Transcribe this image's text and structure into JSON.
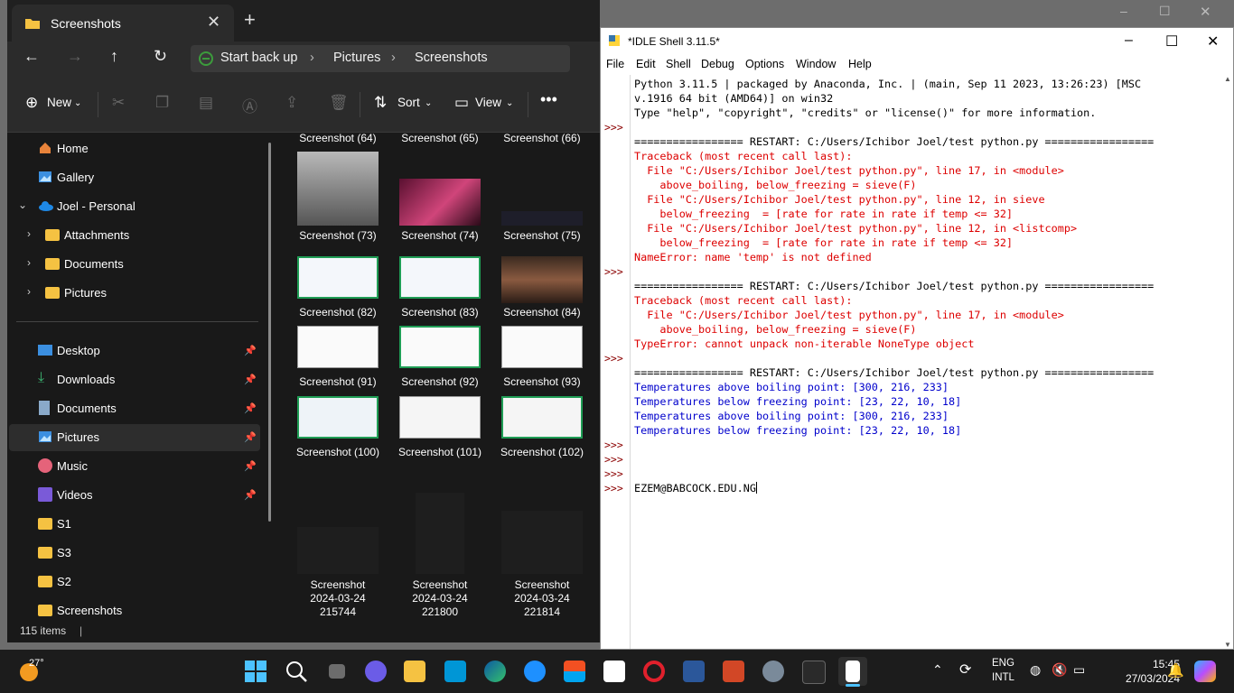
{
  "explorer": {
    "tab_title": "Screenshots",
    "breadcrumb": [
      "Start back up",
      "Pictures",
      "Screenshots"
    ],
    "toolbar": {
      "new_label": "New",
      "sort_label": "Sort",
      "view_label": "View"
    },
    "sidebar": {
      "top": [
        "Home",
        "Gallery",
        "Joel - Personal",
        "Attachments",
        "Documents",
        "Pictures"
      ],
      "quick": [
        "Desktop",
        "Downloads",
        "Documents",
        "Pictures",
        "Music",
        "Videos",
        "S1",
        "S3",
        "S2",
        "Screenshots"
      ]
    },
    "files": [
      "Screenshot (64)",
      "Screenshot (65)",
      "Screenshot (66)",
      "Screenshot (73)",
      "Screenshot (74)",
      "Screenshot (75)",
      "Screenshot (82)",
      "Screenshot (83)",
      "Screenshot (84)",
      "Screenshot (91)",
      "Screenshot (92)",
      "Screenshot (93)",
      "Screenshot (100)",
      "Screenshot (101)",
      "Screenshot (102)"
    ],
    "dated_files": [
      {
        "l1": "Screenshot",
        "l2": "2024-03-24",
        "l3": "215744"
      },
      {
        "l1": "Screenshot",
        "l2": "2024-03-24",
        "l3": "221800"
      },
      {
        "l1": "Screenshot",
        "l2": "2024-03-24",
        "l3": "221814"
      }
    ],
    "status": "115 items"
  },
  "idle": {
    "title": "*IDLE Shell 3.11.5*",
    "menu": [
      "File",
      "Edit",
      "Shell",
      "Debug",
      "Options",
      "Window",
      "Help"
    ],
    "prompt": ">>>",
    "lines": [
      {
        "text": "Python 3.11.5 | packaged by Anaconda, Inc. | (main, Sep 11 2023, 13:26:23) [MSC",
        "kind": "out"
      },
      {
        "text": "v.1916 64 bit (AMD64)] on win32",
        "kind": "out"
      },
      {
        "text": "Type \"help\", \"copyright\", \"credits\" or \"license()\" for more information.",
        "kind": "out"
      },
      {
        "text": "",
        "kind": "out"
      },
      {
        "text": "================= RESTART: C:/Users/Ichibor Joel/test python.py =================",
        "kind": "out"
      },
      {
        "text": "Traceback (most recent call last):",
        "kind": "err"
      },
      {
        "text": "  File \"C:/Users/Ichibor Joel/test python.py\", line 17, in <module>",
        "kind": "err"
      },
      {
        "text": "    above_boiling, below_freezing = sieve(F)",
        "kind": "err"
      },
      {
        "text": "  File \"C:/Users/Ichibor Joel/test python.py\", line 12, in sieve",
        "kind": "err"
      },
      {
        "text": "    below_freezing  = [rate for rate in rate if temp <= 32]",
        "kind": "err"
      },
      {
        "text": "  File \"C:/Users/Ichibor Joel/test python.py\", line 12, in <listcomp>",
        "kind": "err"
      },
      {
        "text": "    below_freezing  = [rate for rate in rate if temp <= 32]",
        "kind": "err"
      },
      {
        "text": "NameError: name 'temp' is not defined",
        "kind": "err"
      },
      {
        "text": "",
        "kind": "out"
      },
      {
        "text": "================= RESTART: C:/Users/Ichibor Joel/test python.py =================",
        "kind": "out"
      },
      {
        "text": "Traceback (most recent call last):",
        "kind": "err"
      },
      {
        "text": "  File \"C:/Users/Ichibor Joel/test python.py\", line 17, in <module>",
        "kind": "err"
      },
      {
        "text": "    above_boiling, below_freezing = sieve(F)",
        "kind": "err"
      },
      {
        "text": "TypeError: cannot unpack non-iterable NoneType object",
        "kind": "err"
      },
      {
        "text": "",
        "kind": "out"
      },
      {
        "text": "================= RESTART: C:/Users/Ichibor Joel/test python.py =================",
        "kind": "out"
      },
      {
        "text": "Temperatures above boiling point: [300, 216, 233]",
        "kind": "blue"
      },
      {
        "text": "Temperatures below freezing point: [23, 22, 10, 18]",
        "kind": "blue"
      },
      {
        "text": "Temperatures above boiling point: [300, 216, 233]",
        "kind": "blue"
      },
      {
        "text": "Temperatures below freezing point: [23, 22, 10, 18]",
        "kind": "blue"
      },
      {
        "text": "",
        "kind": "out"
      },
      {
        "text": "",
        "kind": "out"
      },
      {
        "text": "",
        "kind": "out"
      },
      {
        "text": "EZEM@BABCOCK.EDU.NG",
        "kind": "out"
      }
    ],
    "prompt_rows": [
      3,
      13,
      19,
      25,
      26,
      27,
      28
    ]
  },
  "taskbar": {
    "weather_temp": "27°",
    "lang1": "ENG",
    "lang2": "INTL",
    "time": "15:45",
    "date": "27/03/2024"
  },
  "colors": {
    "accent": "#0a84ff",
    "error": "#dd0000",
    "stdout": "#0000cc",
    "prompt": "#8b0000"
  }
}
